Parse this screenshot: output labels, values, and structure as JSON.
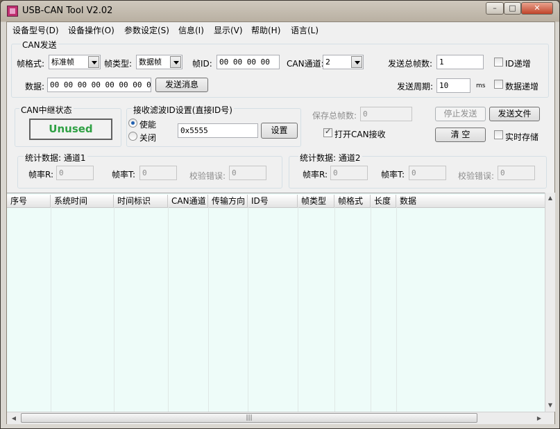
{
  "window": {
    "title": "USB-CAN Tool V2.02",
    "min": "–",
    "max": "□",
    "close": "✕"
  },
  "menu": [
    "设备型号(D)",
    "设备操作(O)",
    "参数设定(S)",
    "信息(I)",
    "显示(V)",
    "帮助(H)",
    "语言(L)"
  ],
  "can_send": {
    "group_label": "CAN发送",
    "frame_format_label": "帧格式:",
    "frame_format_value": "标准帧",
    "frame_type_label": "帧类型:",
    "frame_type_value": "数据帧",
    "frame_id_label": "帧ID:",
    "frame_id_value": "00 00 00 00",
    "channel_label": "CAN通道:",
    "channel_value": "2",
    "total_frames_label": "发送总帧数:",
    "total_frames_value": "1",
    "id_increment_label": "ID递增",
    "data_label": "数据:",
    "data_value": "00 00 00 00 00 00 00 00",
    "send_button": "发送消息",
    "period_label": "发送周期:",
    "period_value": "10",
    "period_unit": "ms",
    "data_increment_label": "数据递增"
  },
  "relay": {
    "label": "CAN中继状态",
    "value": "Unused",
    "value_color": "#2ea043"
  },
  "filter": {
    "label": "接收滤波ID设置(直接ID号)",
    "enable_label": "使能",
    "disable_label": "关闭",
    "id_value": "0x5555",
    "set_button": "设置"
  },
  "controls": {
    "save_total_label": "保存总帧数:",
    "save_total_value": "0",
    "stop_send_button": "停止发送",
    "send_file_button": "发送文件",
    "open_can_rx_label": "打开CAN接收",
    "clear_button": "清 空",
    "realtime_save_label": "实时存储"
  },
  "stats1": {
    "label": "统计数据: 通道1",
    "rate_r_label": "帧率R:",
    "rate_r_value": "0",
    "rate_t_label": "帧率T:",
    "rate_t_value": "0",
    "check_err_label": "校验错误:",
    "check_err_value": "0"
  },
  "stats2": {
    "label": "统计数据: 通道2",
    "rate_r_label": "帧率R:",
    "rate_r_value": "0",
    "rate_t_label": "帧率T:",
    "rate_t_value": "0",
    "check_err_label": "校验错误:",
    "check_err_value": "0"
  },
  "table": {
    "columns": [
      "序号",
      "系统时间",
      "时间标识",
      "CAN通道",
      "传输方向",
      "ID号",
      "帧类型",
      "帧格式",
      "长度",
      "数据"
    ],
    "rows": []
  },
  "scrollbar": {
    "grip": "|||"
  }
}
